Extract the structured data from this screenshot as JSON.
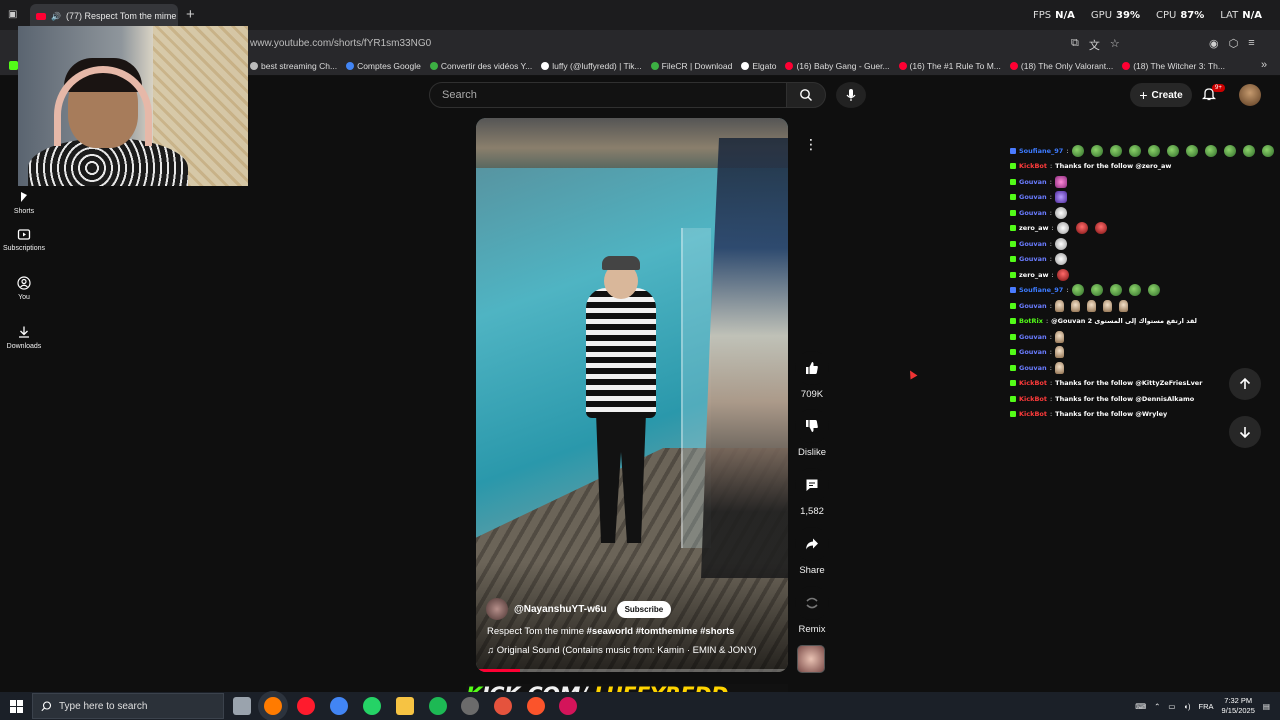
{
  "browser": {
    "tab_title": "(77) Respect Tom the mime",
    "new_tab_label": "+",
    "url": "www.youtube.com/shorts/fYR1sm33NG0",
    "bookmarks": [
      {
        "label": "best streaming Ch...",
        "color": "#bbbbbb"
      },
      {
        "label": "Comptes Google",
        "color": "#4285f4"
      },
      {
        "label": "Convertir des vidéos Y...",
        "color": "#3cb043"
      },
      {
        "label": "luffy (@luffyredd) | Tik...",
        "color": "#ffffff"
      },
      {
        "label": "FileCR | Download",
        "color": "#3cb043"
      },
      {
        "label": "Elgato",
        "color": "#ffffff"
      },
      {
        "label": "(16) Baby Gang - Guer...",
        "color": "#ff0033"
      },
      {
        "label": "(16) The #1 Rule To M...",
        "color": "#ff0033"
      },
      {
        "label": "(18) The Only Valorant...",
        "color": "#ff0033"
      },
      {
        "label": "(18) The Witcher 3: Th...",
        "color": "#ff0033"
      }
    ]
  },
  "overlay_stats": {
    "fps_label": "FPS",
    "fps_value": "N/A",
    "gpu_label": "GPU",
    "gpu_value": "39%",
    "cpu_label": "CPU",
    "cpu_value": "87%",
    "lat_label": "LAT",
    "lat_value": "N/A"
  },
  "youtube": {
    "search_placeholder": "Search",
    "create_label": "Create",
    "notif_count": "9+",
    "nav": [
      {
        "label": "Shorts",
        "icon": "shorts-icon"
      },
      {
        "label": "Subscriptions",
        "icon": "subscriptions-icon"
      },
      {
        "label": "You",
        "icon": "you-icon"
      },
      {
        "label": "Downloads",
        "icon": "downloads-icon"
      }
    ],
    "short": {
      "channel": "@NayanshuYT-w6u",
      "subscribe_label": "Subscribe",
      "title_plain": "Respect Tom the mime ",
      "title_tags": "#seaworld #tomthemime #shorts",
      "sound": "Original Sound (Contains music from: Kamin · EMIN & JONY)",
      "progress": 0.14
    },
    "actions": {
      "likes": "709K",
      "dislike_label": "Dislike",
      "comments": "1,582",
      "share_label": "Share",
      "remix_label": "Remix"
    }
  },
  "chat": [
    {
      "user": "Soufiane_97",
      "user_color": "#3d7bff",
      "msg": "",
      "emotes": [
        "green",
        "green",
        "green",
        "green",
        "green",
        "green",
        "green",
        "green",
        "green",
        "green",
        "green"
      ],
      "badge": "b"
    },
    {
      "user": "KickBot",
      "user_color": "#ff3b3b",
      "msg": "Thanks for the follow @zero_aw",
      "emotes": [],
      "badge": "g"
    },
    {
      "user": "Gouvan",
      "user_color": "#6a7cff",
      "msg": "",
      "emotes": [
        "pink"
      ],
      "badge": "g"
    },
    {
      "user": "Gouvan",
      "user_color": "#6a7cff",
      "msg": "",
      "emotes": [
        "purple"
      ],
      "badge": "g"
    },
    {
      "user": "Gouvan",
      "user_color": "#6a7cff",
      "msg": "",
      "emotes": [
        "white"
      ],
      "badge": "g"
    },
    {
      "user": "zero_aw",
      "user_color": "#ffffff",
      "msg": "",
      "emotes": [
        "white",
        "red",
        "red"
      ],
      "badge": "g"
    },
    {
      "user": "Gouvan",
      "user_color": "#6a7cff",
      "msg": "",
      "emotes": [
        "white"
      ],
      "badge": "g"
    },
    {
      "user": "Gouvan",
      "user_color": "#6a7cff",
      "msg": "",
      "emotes": [
        "white"
      ],
      "badge": "g"
    },
    {
      "user": "zero_aw",
      "user_color": "#ffffff",
      "msg": "",
      "emotes": [
        "red"
      ],
      "badge": "g"
    },
    {
      "user": "Soufiane_97",
      "user_color": "#3d7bff",
      "msg": "",
      "emotes": [
        "green",
        "green",
        "green",
        "green",
        "green"
      ],
      "badge": "b"
    },
    {
      "user": "Gouvan",
      "user_color": "#6a7cff",
      "msg": "",
      "emotes": [
        "hand",
        "hand",
        "hand",
        "hand",
        "hand"
      ],
      "badge": "g"
    },
    {
      "user": "BotRix",
      "user_color": "#53fc18",
      "msg": "@Gouvan لقد ارتفع مستواك إلى المستوى 2",
      "emotes": [],
      "badge": "g"
    },
    {
      "user": "Gouvan",
      "user_color": "#6a7cff",
      "msg": "",
      "emotes": [
        "hand"
      ],
      "badge": "g"
    },
    {
      "user": "Gouvan",
      "user_color": "#6a7cff",
      "msg": "",
      "emotes": [
        "hand"
      ],
      "badge": "g"
    },
    {
      "user": "Gouvan",
      "user_color": "#6a7cff",
      "msg": "",
      "emotes": [
        "hand"
      ],
      "badge": "g"
    },
    {
      "user": "KickBot",
      "user_color": "#ff3b3b",
      "msg": "Thanks for the follow @KittyZeFriesLver",
      "emotes": [],
      "badge": "g"
    },
    {
      "user": "KickBot",
      "user_color": "#ff3b3b",
      "msg": "Thanks for the follow @DennisAlkamo",
      "emotes": [],
      "badge": "g"
    },
    {
      "user": "KickBot",
      "user_color": "#ff3b3b",
      "msg": "Thanks for the follow @Wryley",
      "emotes": [],
      "badge": "g"
    }
  ],
  "kick_banner": {
    "k": "K",
    "rest": "ICK.COM/ ",
    "handle": "LUFFYREDD"
  },
  "taskbar": {
    "search_placeholder": "Type here to search",
    "language": "FRA",
    "time": "7:32 PM",
    "date": "9/15/2025",
    "apps": [
      {
        "name": "task-view-icon",
        "color": "#9aa3ad"
      },
      {
        "name": "firefox-icon",
        "color": "#ff7b00"
      },
      {
        "name": "opera-icon",
        "color": "#ff1b2d"
      },
      {
        "name": "chrome-icon",
        "color": "#4285f4"
      },
      {
        "name": "whatsapp-icon",
        "color": "#25d366"
      },
      {
        "name": "file-explorer-icon",
        "color": "#f6c343"
      },
      {
        "name": "spotify-icon",
        "color": "#1db954"
      },
      {
        "name": "obs-icon",
        "color": "#6b6b6b"
      },
      {
        "name": "app-orange-icon",
        "color": "#e5533d"
      },
      {
        "name": "brave-icon",
        "color": "#fb542b"
      },
      {
        "name": "app-red-icon",
        "color": "#d4145a"
      }
    ]
  }
}
